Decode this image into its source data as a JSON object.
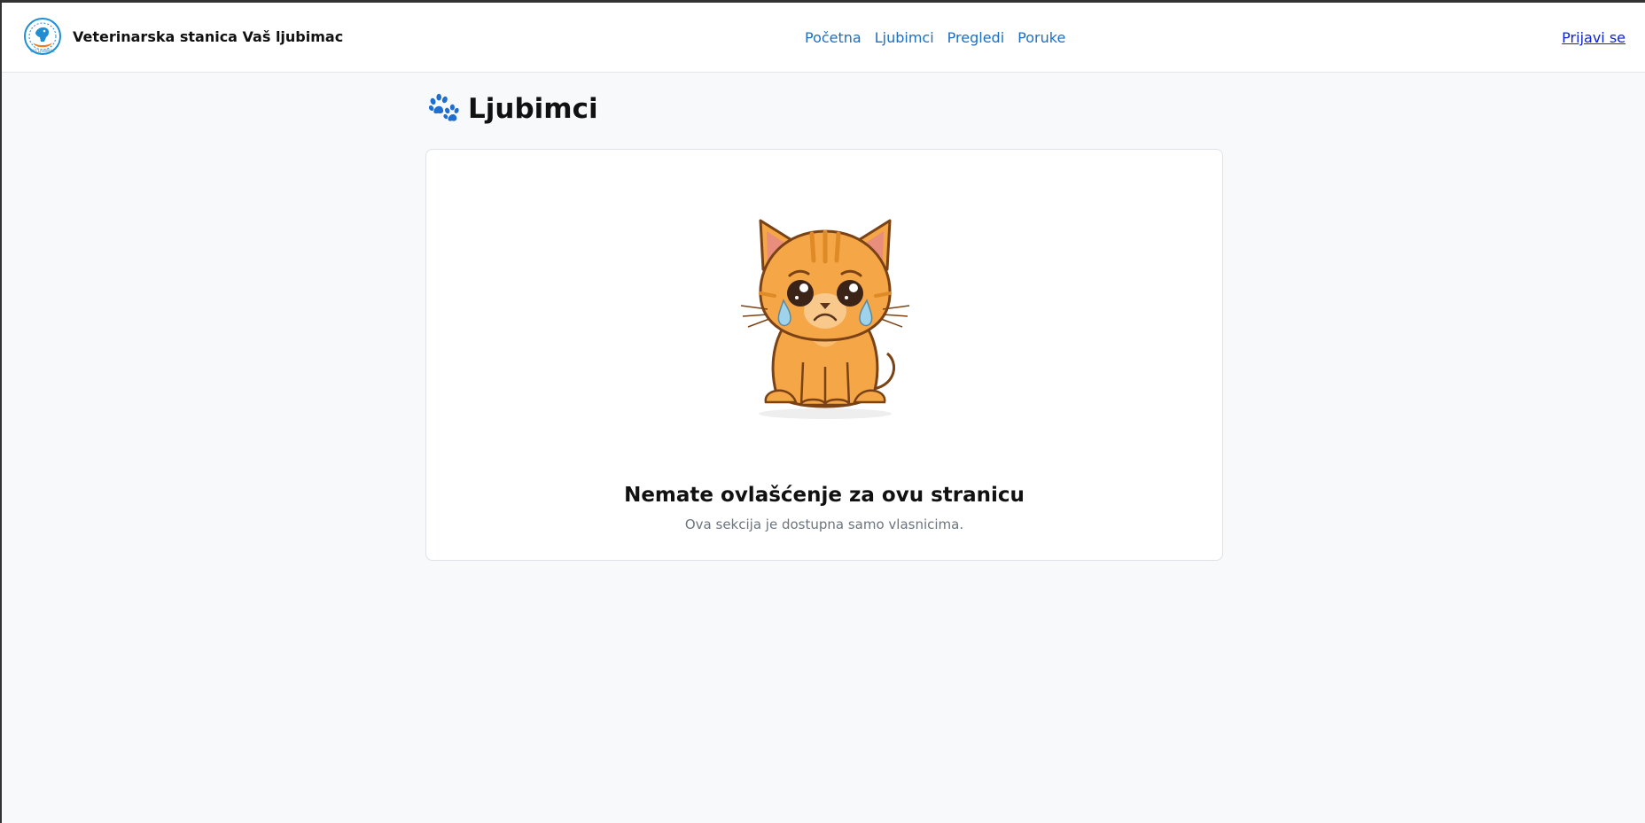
{
  "brand": {
    "name": "Veterinarska stanica Vaš ljubimac",
    "logo_icon": "veterinary-logo-icon"
  },
  "nav": {
    "items": [
      {
        "label": "Početna"
      },
      {
        "label": "Ljubimci"
      },
      {
        "label": "Pregledi"
      },
      {
        "label": "Poruke"
      }
    ],
    "login_label": "Prijavi se"
  },
  "page": {
    "title": "Ljubimci",
    "title_icon": "paw-icon"
  },
  "message": {
    "illustration": "sad-cat-icon",
    "title": "Nemate ovlašćenje za ovu stranicu",
    "subtitle": "Ova sekcija je dostupna samo vlasnicima."
  },
  "colors": {
    "nav_link": "#1a6fc4",
    "login_link": "#0d23d6",
    "background": "#f8f9fa",
    "paw": "#1f6fd1",
    "cat_fur": "#f5a646"
  }
}
